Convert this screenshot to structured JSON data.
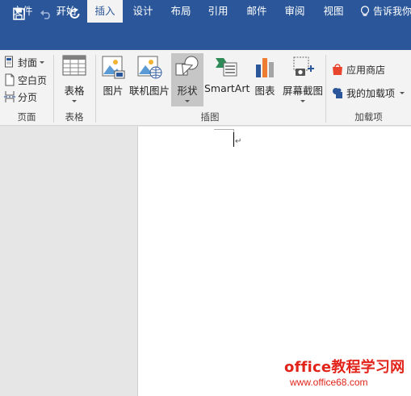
{
  "quick_access": {
    "save_icon": "save-icon",
    "undo_icon": "undo-icon",
    "redo_icon": "repeat-icon",
    "customize_icon": "customize-qat-icon"
  },
  "tabs": [
    {
      "label": "文件",
      "active": false
    },
    {
      "label": "开始",
      "active": false
    },
    {
      "label": "插入",
      "active": true
    },
    {
      "label": "设计",
      "active": false
    },
    {
      "label": "布局",
      "active": false
    },
    {
      "label": "引用",
      "active": false
    },
    {
      "label": "邮件",
      "active": false
    },
    {
      "label": "审阅",
      "active": false
    },
    {
      "label": "视图",
      "active": false
    }
  ],
  "tell_me": "告诉我你",
  "ribbon": {
    "pages_group": {
      "label": "页面",
      "cover": "封面",
      "blank": "空白页",
      "break": "分页"
    },
    "tables_group": {
      "label": "表格",
      "table": "表格"
    },
    "illustrations_group": {
      "label": "插图",
      "picture": "图片",
      "online_picture": "联机图片",
      "shapes": "形状",
      "smartart": "SmartArt",
      "chart": "图表",
      "screenshot": "屏幕截图"
    },
    "addins_group": {
      "label": "加载项",
      "store": "应用商店",
      "my_addins": "我的加载项"
    }
  },
  "watermark": {
    "title": "office教程学习网",
    "url": "www.office68.com"
  },
  "colors": {
    "brand": "#2b579a",
    "ribbon_bg": "#f3f3f3",
    "watermark": "#e2231a"
  }
}
